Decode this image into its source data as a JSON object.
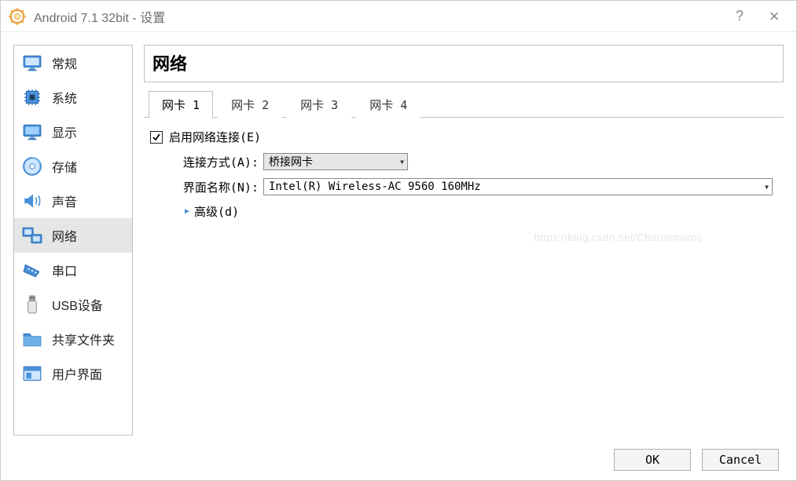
{
  "window": {
    "title": "Android 7.1 32bit - 设置",
    "help": "?",
    "close": "×"
  },
  "sidebar": {
    "items": [
      {
        "label": "常规"
      },
      {
        "label": "系统"
      },
      {
        "label": "显示"
      },
      {
        "label": "存储"
      },
      {
        "label": "声音"
      },
      {
        "label": "网络"
      },
      {
        "label": "串口"
      },
      {
        "label": "USB设备"
      },
      {
        "label": "共享文件夹"
      },
      {
        "label": "用户界面"
      }
    ],
    "selected_index": 5
  },
  "main": {
    "title": "网络",
    "tabs": [
      {
        "label": "网卡 1"
      },
      {
        "label": "网卡 2"
      },
      {
        "label": "网卡 3"
      },
      {
        "label": "网卡 4"
      }
    ],
    "active_tab_index": 0,
    "form": {
      "enable_label": "启用网络连接(E)",
      "enable_checked": true,
      "conn_label": "连接方式(A):",
      "conn_value": "桥接网卡",
      "iface_label": "界面名称(N):",
      "iface_value": "Intel(R) Wireless-AC 9560 160MHz",
      "advanced_label": "高级(d)"
    }
  },
  "footer": {
    "ok": "OK",
    "cancel": "Cancel"
  },
  "watermark": "https://blog.csdn.net/Charonmomo"
}
